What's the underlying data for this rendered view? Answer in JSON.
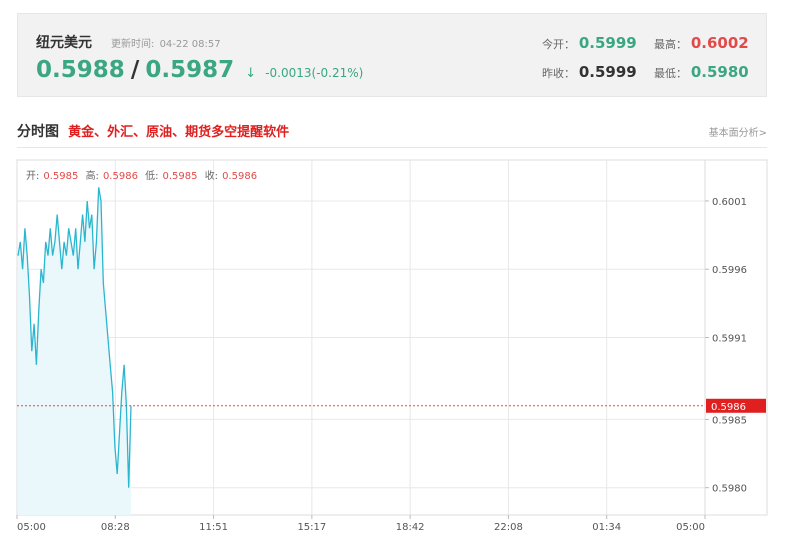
{
  "quote": {
    "name": "纽元美元",
    "update_label": "更新时间:",
    "update_time": "04-22 08:57",
    "bid": "0.5988",
    "slash": "/",
    "ask": "0.5987",
    "arrow": "↓",
    "change": "-0.0013(-0.21%)",
    "open_label": "今开：",
    "open": "0.5999",
    "high_label": "最高：",
    "high": "0.6002",
    "prevclose_label": "昨收：",
    "prevclose": "0.5999",
    "low_label": "最低：",
    "low": "0.5980",
    "colors": {
      "up": "#e24a4a",
      "down": "#3aa682",
      "line": "#2bb6cf",
      "fill": "#eaf7fb"
    }
  },
  "section": {
    "title": "分时图",
    "promo": "黄金、外汇、原油、期货多空提醒软件",
    "link": "基本面分析>"
  },
  "ohlc": {
    "open_label": "开:",
    "open": "0.5985",
    "high_label": "高:",
    "high": "0.5986",
    "low_label": "低:",
    "low": "0.5985",
    "close_label": "收:",
    "close": "0.5986"
  },
  "chart_data": {
    "type": "area",
    "title": "",
    "xlabel": "",
    "ylabel": "",
    "x_ticks": [
      "05:00",
      "08:28",
      "11:51",
      "15:17",
      "18:42",
      "22:08",
      "01:34",
      "05:00"
    ],
    "y_ticks": [
      "0.6001",
      "0.5996",
      "0.5991",
      "0.5985",
      "0.5980"
    ],
    "y_tick_values": [
      0.6001,
      0.5996,
      0.5991,
      0.5985,
      0.598
    ],
    "ylim": [
      0.5978,
      0.6004
    ],
    "current_price": 0.5986,
    "current_price_label": "0.5986",
    "grid": true,
    "series": [
      {
        "values": [
          0.5997,
          0.5998,
          0.5996,
          0.5999,
          0.5997,
          0.5994,
          0.599,
          0.5992,
          0.5989,
          0.5993,
          0.5996,
          0.5995,
          0.5998,
          0.5997,
          0.5999,
          0.5997,
          0.5998,
          0.6,
          0.5998,
          0.5996,
          0.5998,
          0.5997,
          0.5999,
          0.5998,
          0.5997,
          0.5999,
          0.5996,
          0.5998,
          0.6,
          0.5998,
          0.6001,
          0.5999,
          0.6,
          0.5996,
          0.5998,
          0.6002,
          0.6001,
          0.5995,
          0.5993,
          0.5991,
          0.5989,
          0.5987,
          0.5983,
          0.5981,
          0.5984,
          0.5987,
          0.5989,
          0.5986,
          0.598,
          0.5986
        ]
      }
    ]
  }
}
